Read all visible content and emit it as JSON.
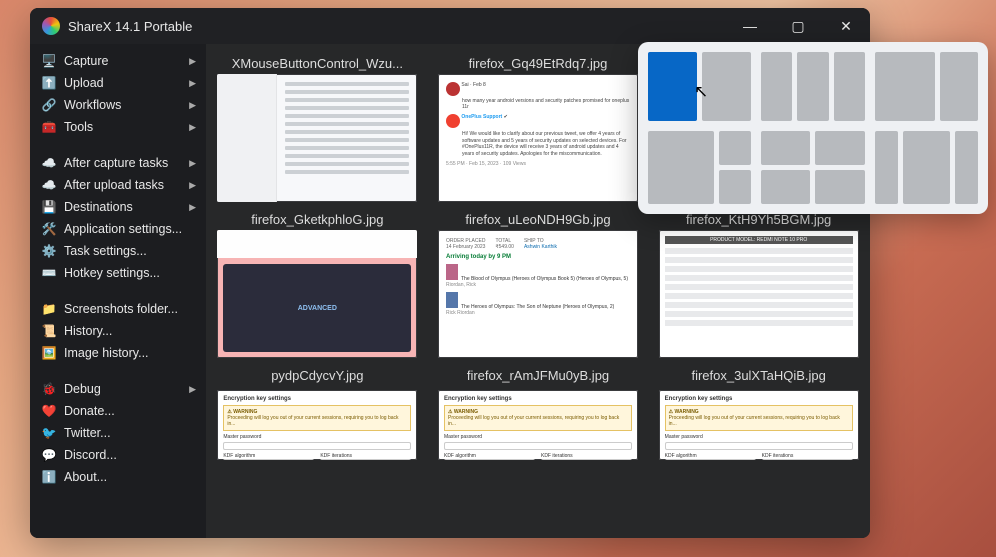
{
  "title": "ShareX 14.1 Portable",
  "win_buttons": {
    "min": "—",
    "max": "▢",
    "close": "✕"
  },
  "sidebar": {
    "main": [
      {
        "icon": "🖥️",
        "label": "Capture",
        "sub": true
      },
      {
        "icon": "⬆️",
        "label": "Upload",
        "sub": true
      },
      {
        "icon": "🔗",
        "label": "Workflows",
        "sub": true
      },
      {
        "icon": "🧰",
        "label": "Tools",
        "sub": true
      }
    ],
    "tasks": [
      {
        "icon": "☁️",
        "label": "After capture tasks",
        "sub": true
      },
      {
        "icon": "☁️",
        "label": "After upload tasks",
        "sub": true
      },
      {
        "icon": "💾",
        "label": "Destinations",
        "sub": true
      },
      {
        "icon": "🛠️",
        "label": "Application settings..."
      },
      {
        "icon": "⚙️",
        "label": "Task settings..."
      },
      {
        "icon": "⌨️",
        "label": "Hotkey settings..."
      }
    ],
    "misc": [
      {
        "icon": "📁",
        "label": "Screenshots folder..."
      },
      {
        "icon": "📜",
        "label": "History..."
      },
      {
        "icon": "🖼️",
        "label": "Image history..."
      }
    ],
    "footer": [
      {
        "icon": "🐞",
        "label": "Debug",
        "sub": true
      },
      {
        "icon": "❤️",
        "label": "Donate..."
      },
      {
        "icon": "🐦",
        "label": "Twitter..."
      },
      {
        "icon": "💬",
        "label": "Discord..."
      },
      {
        "icon": "ℹ️",
        "label": "About..."
      }
    ]
  },
  "thumbs": [
    {
      "name": "XMouseButtonControl_Wzu...",
      "kind": "settings"
    },
    {
      "name": "firefox_Gq49EtRdq7.jpg",
      "kind": "tweet"
    },
    {
      "name": "",
      "kind": "hidden"
    },
    {
      "name": "firefox_GketkphloG.jpg",
      "kind": "pink"
    },
    {
      "name": "firefox_uLeoNDH9Gb.jpg",
      "kind": "order"
    },
    {
      "name": "firefox_KtH9Yh5BGM.jpg",
      "kind": "table"
    },
    {
      "name": "pydpCdycvY.jpg",
      "kind": "enc"
    },
    {
      "name": "firefox_rAmJFMu0yB.jpg",
      "kind": "enc"
    },
    {
      "name": "firefox_3ulXTaHQiB.jpg",
      "kind": "enc"
    }
  ],
  "mini": {
    "tweet_handle": "OnePlus Support",
    "tweet_body": "Hi! We would like to clarify about our previous tweet, we offer 4 years of software updates and 5 years of security updates on selected devices. For #OnePlus11R, the device will receive 3 years of android updates and 4 years of security updates. Apologies for the miscommunication.",
    "tweet_meta": "5:55 PM · Feb 15, 2023 · 109 Views",
    "order_status": "Arriving today by 9 PM",
    "order_item1": "The Blood of Olympus (Heroes of Olympus Book 5) (Heroes of Olympus, 5)",
    "order_item2": "The Heroes of Olympus: The Son of Neptune (Heroes of Olympus, 2)",
    "table_header": "PRODUCT MODEL: REDMI NOTE 10 PRO",
    "enc_title": "Encryption key settings",
    "enc_warning": "⚠ WARNING",
    "enc_f1": "KDF algorithm",
    "enc_f2": "KDF iterations"
  }
}
